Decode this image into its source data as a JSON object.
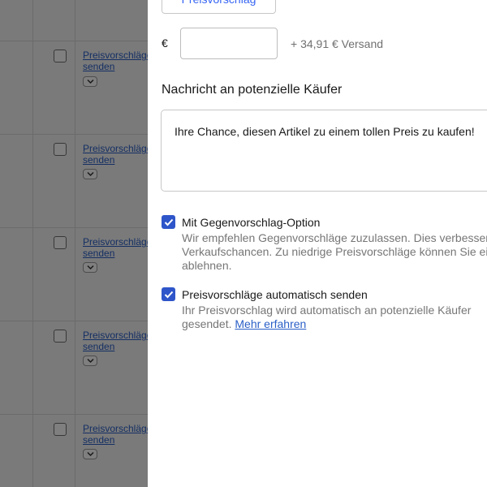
{
  "background": {
    "rows": [
      {
        "link_line1": "Preisvorschläge",
        "link_line2": "senden"
      },
      {
        "link_line1": "Preisvorschläge",
        "link_line2": "senden"
      },
      {
        "link_line1": "Preisvorschläge",
        "link_line2": "senden"
      },
      {
        "link_line1": "Preisvorschläge",
        "link_line2": "senden"
      },
      {
        "link_line1": "Preisvorschläge",
        "link_line2": "senden"
      }
    ]
  },
  "panel": {
    "top_button_label": "Preisvorschlag",
    "price": {
      "currency_symbol": "€",
      "value": "",
      "shipping_note": "+ 34,91 € Versand"
    },
    "message": {
      "heading": "Nachricht an potenzielle Käufer",
      "text": "Ihre Chance, diesen Artikel zu einem tollen Preis zu kaufen!"
    },
    "options": {
      "counter_offer": {
        "checked": true,
        "label": "Mit Gegenvorschlag-Option",
        "desc_line1": "Wir empfehlen Gegenvorschläge zuzulassen. Dies verbessert",
        "desc_line2": "Verkaufschancen. Zu niedrige Preisvorschläge können Sie ei",
        "desc_line3": "ablehnen."
      },
      "auto_send": {
        "checked": true,
        "label": "Preisvorschläge automatisch senden",
        "desc_line1": "Ihr Preisvorschlag wird automatisch an potenzielle Käufer",
        "desc_line2": "gesendet.",
        "learn_more": "Mehr erfahren"
      }
    }
  },
  "colors": {
    "accent": "#3665f3",
    "checkbox": "#2e55c9",
    "link": "#2a5fc7",
    "overlay": "rgba(0,0,0,0.5)"
  }
}
